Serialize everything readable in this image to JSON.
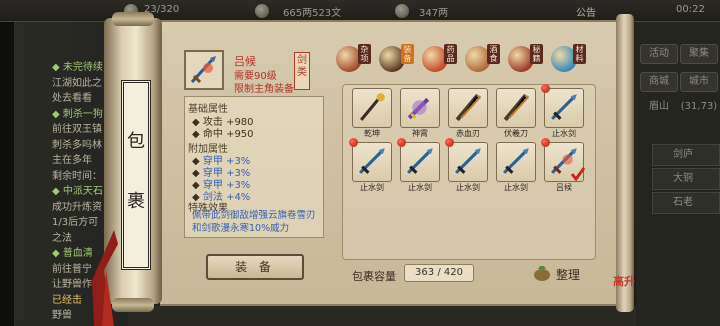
{
  "topbar": {
    "count": "23/320",
    "money": "665两523文",
    "gems": "347两",
    "announcement": "公告",
    "time": "00:22"
  },
  "quests": [
    {
      "text": "◆ 未完待续",
      "style": "title"
    },
    {
      "text": "江湖如此之",
      "style": ""
    },
    {
      "text": "处去看看",
      "style": ""
    },
    {
      "text": "◆ 刺杀一狗",
      "style": "title"
    },
    {
      "text": "前往双王镇",
      "style": ""
    },
    {
      "text": "刺杀多吗林",
      "style": ""
    },
    {
      "text": "主在多年",
      "style": ""
    },
    {
      "text": "剩余时间：",
      "style": ""
    },
    {
      "text": "◆ 中派天石",
      "style": "title"
    },
    {
      "text": "成功升炼资",
      "style": ""
    },
    {
      "text": "1/3后方可",
      "style": ""
    },
    {
      "text": "之法",
      "style": ""
    },
    {
      "text": "◆ 普血清",
      "style": "title"
    },
    {
      "text": "前往普宁",
      "style": ""
    },
    {
      "text": "让野兽作",
      "style": ""
    },
    {
      "text": "已经击",
      "style": "yellow"
    },
    {
      "text": "野兽",
      "style": ""
    }
  ],
  "right_sidebar": {
    "buttons": [
      "活动",
      "聚集",
      "商城",
      "城市",
      "眉山",
      "(31,73)"
    ],
    "tabs": [
      "剑庐",
      "大铜",
      "石老"
    ]
  },
  "scroll_title": [
    "包",
    "裹"
  ],
  "item": {
    "name": "吕候",
    "req_level": "需要90级",
    "req_restrict": "限制主角装备",
    "type_stamp": "剑类",
    "base_header": "基础属性",
    "base_stats": [
      {
        "label": "攻击",
        "value": "+980"
      },
      {
        "label": "命中",
        "value": "+950"
      }
    ],
    "extra_header": "附加属性",
    "extra_stats": [
      {
        "label": "穿甲",
        "value": "+3%"
      },
      {
        "label": "穿甲",
        "value": "+3%"
      },
      {
        "label": "穿甲",
        "value": "+3%"
      },
      {
        "label": "剑法",
        "value": "+4%"
      }
    ],
    "effect_header": "特殊效果",
    "effect_text": "佩带此剑御敌增强云旗卷雪刃和剑歌漫永寒10%威力",
    "equip_label": "装 备"
  },
  "categories": [
    {
      "label": "杂项",
      "color": "#a04a2b",
      "active": false
    },
    {
      "label": "装备",
      "color": "#5a3a22",
      "active": true
    },
    {
      "label": "药品",
      "color": "#c24a2c",
      "active": false
    },
    {
      "label": "酒食",
      "color": "#b06a3b",
      "active": false
    },
    {
      "label": "秘籍",
      "color": "#9b3b28",
      "active": false
    },
    {
      "label": "材料",
      "color": "#3b88b8",
      "active": false
    }
  ],
  "slots": [
    {
      "name": "乾坤",
      "dot": false,
      "check": false,
      "icon": "staff-icon"
    },
    {
      "name": "神霄",
      "dot": false,
      "check": false,
      "icon": "purple-sword-icon"
    },
    {
      "name": "赤血刃",
      "dot": false,
      "check": false,
      "icon": "blade-icon"
    },
    {
      "name": "伏羲刀",
      "dot": false,
      "check": false,
      "icon": "blade-icon"
    },
    {
      "name": "止水剑",
      "dot": true,
      "check": false,
      "icon": "sword-icon"
    },
    {
      "name": "止水剑",
      "dot": true,
      "check": false,
      "icon": "sword-icon"
    },
    {
      "name": "止水剑",
      "dot": true,
      "check": false,
      "icon": "sword-icon"
    },
    {
      "name": "止水剑",
      "dot": true,
      "check": false,
      "icon": "sword-icon"
    },
    {
      "name": "止水剑",
      "dot": false,
      "check": false,
      "icon": "sword-icon"
    },
    {
      "name": "吕候",
      "dot": true,
      "check": true,
      "icon": "red-sword-icon"
    }
  ],
  "capacity": {
    "label": "包裹容量",
    "value": "363 / 420"
  },
  "sort_label": "整理",
  "seal": "高升"
}
